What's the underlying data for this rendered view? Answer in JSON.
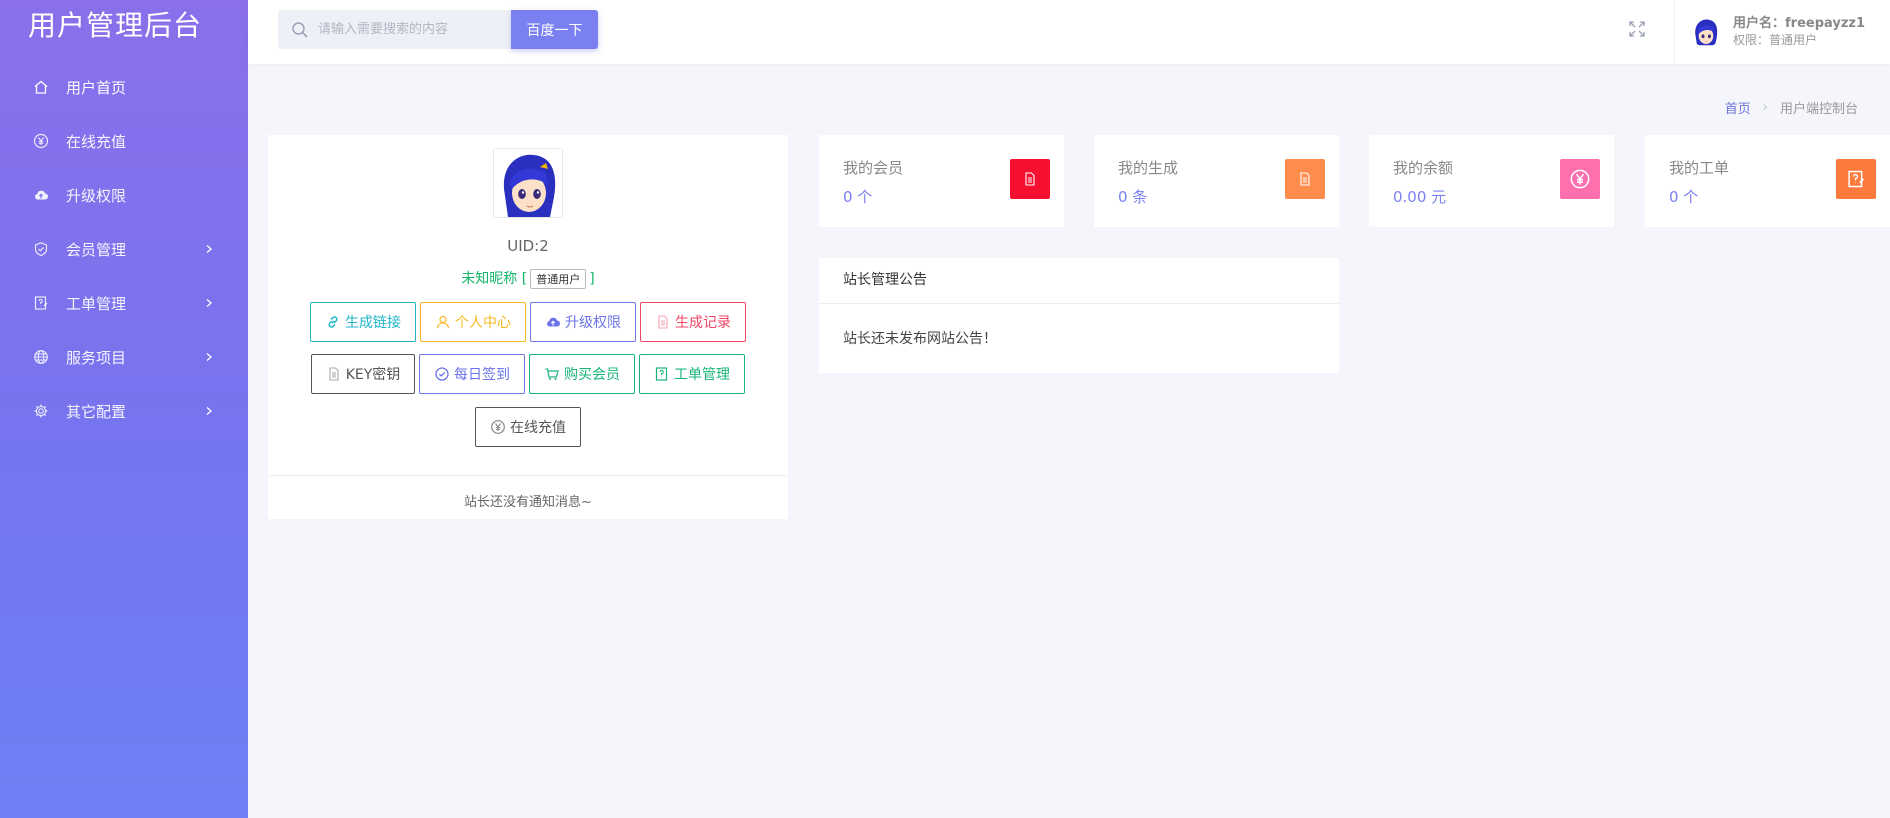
{
  "app": {
    "brand": "用户管理后台"
  },
  "sidebar": {
    "items": [
      {
        "label": "用户首页",
        "icon": "home-icon",
        "arrow": false
      },
      {
        "label": "在线充值",
        "icon": "yen-icon",
        "arrow": false
      },
      {
        "label": "升级权限",
        "icon": "cloud-upload-icon",
        "arrow": false
      },
      {
        "label": "会员管理",
        "icon": "shield-icon",
        "arrow": true
      },
      {
        "label": "工单管理",
        "icon": "ticket-icon",
        "arrow": true
      },
      {
        "label": "服务项目",
        "icon": "globe-icon",
        "arrow": true
      },
      {
        "label": "其它配置",
        "icon": "gear-icon",
        "arrow": true
      }
    ]
  },
  "search": {
    "placeholder": "请输入需要搜索的内容",
    "button": "百度一下"
  },
  "user": {
    "name": "用户名：freepayzz1",
    "role": "权限：普通用户"
  },
  "breadcrumb": {
    "home": "首页",
    "current": "用户端控制台"
  },
  "profile": {
    "uid": "UID:2",
    "nickname": "未知昵称 [",
    "nickname_close": "]",
    "role_tag": "普通用户",
    "buttons": [
      {
        "label": "生成链接",
        "color": "#1fb5c7",
        "icon": "link-icon"
      },
      {
        "label": "个人中心",
        "color": "#f7b924",
        "icon": "user-icon"
      },
      {
        "label": "升级权限",
        "color": "#6c74e8",
        "icon": "cloud-upload-icon"
      },
      {
        "label": "生成记录",
        "color": "#f14668",
        "icon": "file-icon"
      },
      {
        "label": "KEY密钥",
        "color": "#555555",
        "icon": "file-icon"
      },
      {
        "label": "每日签到",
        "color": "#6c74e8",
        "icon": "check-circle-icon"
      },
      {
        "label": "购买会员",
        "color": "#18b57a",
        "icon": "cart-icon"
      },
      {
        "label": "工单管理",
        "color": "#18b57a",
        "icon": "ticket-icon"
      },
      {
        "label": "在线充值",
        "color": "#555555",
        "icon": "yen-icon"
      }
    ],
    "footer": "站长还没有通知消息~"
  },
  "stats": [
    {
      "label": "我的会员",
      "value": "0 个",
      "color": "#f5102f",
      "icon": "file-icon"
    },
    {
      "label": "我的生成",
      "value": "0 条",
      "color": "#fd8c4d",
      "icon": "file-icon"
    },
    {
      "label": "我的余额",
      "value": "0.00 元",
      "color": "#fd70ad",
      "icon": "yen-icon"
    },
    {
      "label": "我的工单",
      "value": "0 个",
      "color": "#fd7a3d",
      "icon": "ticket-icon"
    }
  ],
  "notice": {
    "title": "站长管理公告",
    "body": "站长还未发布网站公告！"
  }
}
